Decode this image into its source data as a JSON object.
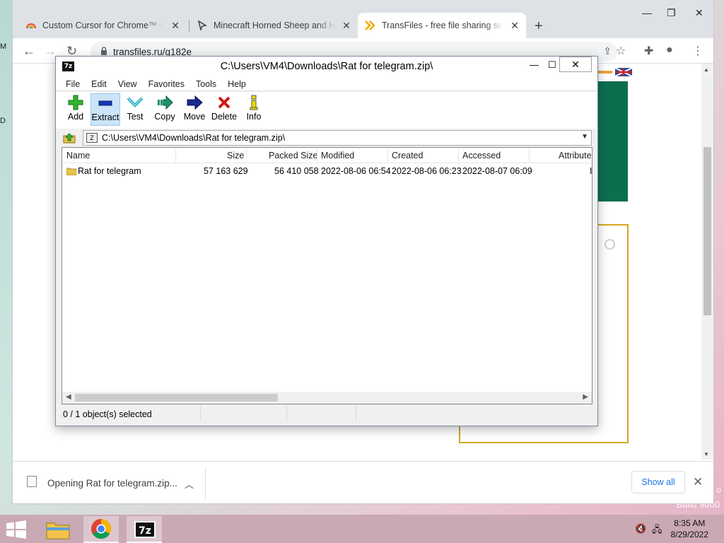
{
  "desktop": {
    "edge_letter_1": "M",
    "edge_letter_2": "D",
    "watermark_line1": "o",
    "watermark_line2": "Build 9600"
  },
  "browser": {
    "tabs": [
      {
        "title": "Custom Cursor for Chrome™ - Cl",
        "icon": "rainbow-cursor-icon"
      },
      {
        "title": "Minecraft Horned Sheep and Hor",
        "icon": "cursor-arrow-icon"
      },
      {
        "title": "TransFiles - free file sharing servi",
        "icon": "transfiles-chevron-icon"
      }
    ],
    "url": "transfiles.ru/q182e",
    "download": {
      "label": "Opening Rat for telegram.zip...",
      "show_all": "Show all"
    },
    "accent_green": "#0b6e4f",
    "accent_gold": "#d7a520"
  },
  "sevenzip": {
    "title": "C:\\Users\\VM4\\Downloads\\Rat for telegram.zip\\",
    "menu": [
      "File",
      "Edit",
      "View",
      "Favorites",
      "Tools",
      "Help"
    ],
    "toolbar": [
      "Add",
      "Extract",
      "Test",
      "Copy",
      "Move",
      "Delete",
      "Info"
    ],
    "address": "C:\\Users\\VM4\\Downloads\\Rat for telegram.zip\\",
    "columns": [
      "Name",
      "Size",
      "Packed Size",
      "Modified",
      "Created",
      "Accessed",
      "Attribute"
    ],
    "rows": [
      {
        "name": "Rat for telegram",
        "size": "57 163 629",
        "packed": "56 410 058",
        "modified": "2022-08-06 06:54",
        "created": "2022-08-06 06:23",
        "accessed": "2022-08-07 06:09",
        "attr": "I"
      }
    ],
    "status": "0 / 1 object(s) selected"
  },
  "taskbar": {
    "time": "8:35 AM",
    "date": "8/29/2022"
  }
}
